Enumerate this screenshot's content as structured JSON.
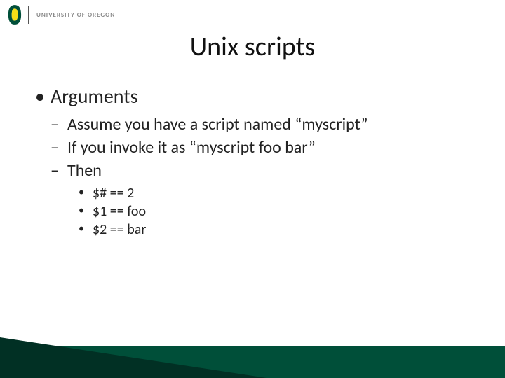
{
  "header": {
    "university": "UNIVERSITY OF OREGON"
  },
  "title": "Unix scripts",
  "bullets": {
    "arguments": "Arguments",
    "sub": {
      "assume": "Assume you have a script named “myscript”",
      "invoke": "If you invoke it as “myscript foo bar”",
      "then": "Then"
    },
    "subsub": {
      "a": "$# == 2",
      "b": "$1 == foo",
      "c": "$2 == bar"
    }
  },
  "colors": {
    "brand_green": "#004f39",
    "brand_dark": "#013024",
    "logo_yellow": "#f7e017"
  }
}
